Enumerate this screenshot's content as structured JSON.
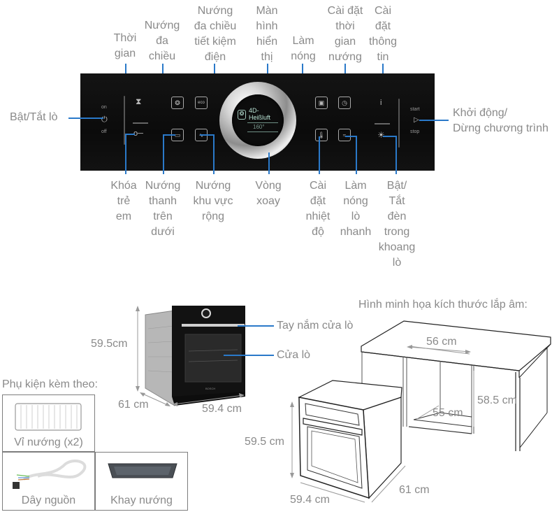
{
  "control_panel": {
    "top_labels": [
      {
        "id": "timer",
        "text": "Thời\ngian"
      },
      {
        "id": "multi_bake",
        "text": "Nướng\nđa\nchiều"
      },
      {
        "id": "eco_bake",
        "text": "Nướng\nđa chiều\ntiết kiệm\nđiện"
      },
      {
        "id": "display",
        "text": "Màn\nhình\nhiển\nthị"
      },
      {
        "id": "preheat",
        "text": "Làm\nnóng"
      },
      {
        "id": "cook_time",
        "text": "Cài đặt\nthời\ngian\nnướng"
      },
      {
        "id": "info",
        "text": "Cài\nđặt\nthông\ntin"
      }
    ],
    "bottom_labels": [
      {
        "id": "child_lock",
        "text": "Khóa\ntrẻ\nem"
      },
      {
        "id": "top_bottom",
        "text": "Nướng\nthanh\ntrên\ndưới"
      },
      {
        "id": "wide_grill",
        "text": "Nướng\nkhu vực\nrộng"
      },
      {
        "id": "dial",
        "text": "Vòng\nxoay"
      },
      {
        "id": "temperature",
        "text": "Cài\nđặt\nnhiệt\nđộ"
      },
      {
        "id": "fast_preheat",
        "text": "Làm\nnóng\nlò\nnhanh"
      },
      {
        "id": "light",
        "text": "Bật/\nTắt\nđèn\ntrong\nkhoang\nlò"
      }
    ],
    "side_labels": {
      "power": "Bật/Tắt lò",
      "start_stop": "Khởi động/\nDừng chương trình"
    },
    "panel_text": {
      "on": "on",
      "off": "off",
      "start": "start",
      "stop": "stop",
      "display_mode_line1": "4D-",
      "display_mode_line2": "Heißluft",
      "display_temp": "160°"
    },
    "icons": {
      "power": "power-icon",
      "timer": "hourglass-icon",
      "child_lock": "key-icon",
      "multi_bake": "fan-icon",
      "eco_bake": "eco-fan-icon",
      "top_bottom": "top-bottom-heat-icon",
      "wide_grill": "grill-icon",
      "preheat": "preheat-icon",
      "cook_time": "clock-icon",
      "temperature": "thermometer-icon",
      "fast_preheat": "fast-heat-icon",
      "info": "info-icon",
      "light": "lightbulb-icon",
      "start_stop": "play-icon"
    },
    "accent_line_color": "#2a79c9"
  },
  "oven_photo": {
    "height_label": "59.5cm",
    "depth_label": "61 cm",
    "width_label": "59.4 cm",
    "handle_label": "Tay nắm cửa lò",
    "door_label": "Cửa lò"
  },
  "accessories": {
    "title": "Phụ kiện kèm theo:",
    "items": [
      {
        "label": "Vỉ nướng (x2)",
        "icon": "wire-rack-icon"
      },
      {
        "label": "Dây nguồn",
        "icon": "power-cable-icon"
      },
      {
        "label": "Khay nướng",
        "icon": "baking-tray-icon"
      }
    ]
  },
  "installation": {
    "title": "Hình minh họa kích thước lắp âm:",
    "cabinet_width": "56 cm",
    "cabinet_depth": "55 cm",
    "cabinet_height": "58.5 cm",
    "oven_height": "59.5 cm",
    "oven_width": "59.4 cm",
    "oven_depth": "61 cm"
  }
}
